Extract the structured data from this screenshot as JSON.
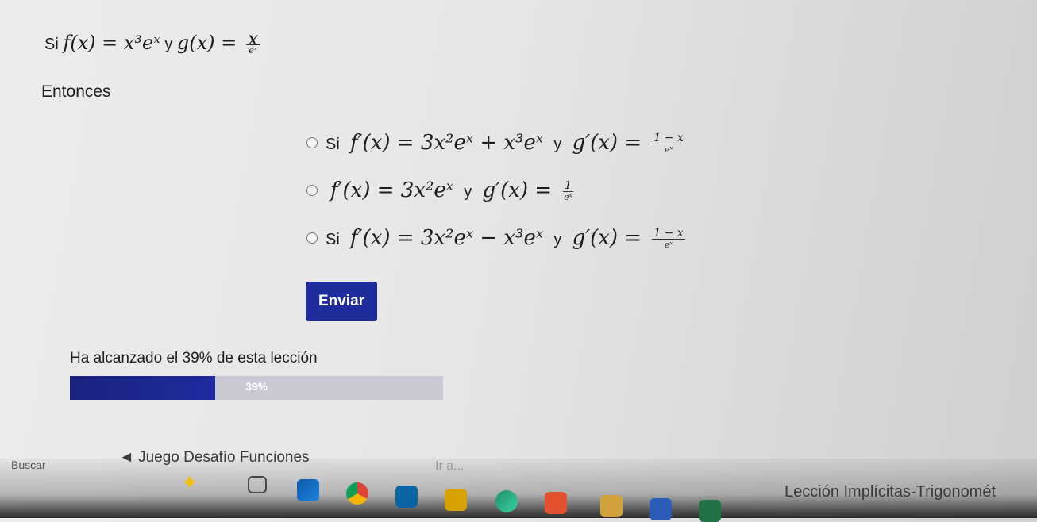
{
  "question": {
    "si": "Si",
    "f": "f(x) = x³eˣ",
    "y": "y",
    "g_lhs": "g(x) =",
    "g_num": "x",
    "g_den": "eˣ"
  },
  "entonces": "Entonces",
  "options": [
    {
      "si": "Si",
      "f": "f′(x) = 3x²eˣ + x³eˣ",
      "y": "y",
      "g_lhs": "g′(x) =",
      "g_num": "1 − x",
      "g_den": "eˣ"
    },
    {
      "si": "",
      "f": "f′(x) = 3x²eˣ",
      "y": "y",
      "g_lhs": "g′(x) =",
      "g_num": "1",
      "g_den": "eˣ"
    },
    {
      "si": "Si",
      "f": "f′(x) = 3x²eˣ − x³eˣ",
      "y": "y",
      "g_lhs": "g′(x) =",
      "g_num": "1 − x",
      "g_den": "eˣ"
    }
  ],
  "submit_label": "Enviar",
  "progress": {
    "label": "Ha alcanzado el 39% de esta lección",
    "percent": 39,
    "text": "39%"
  },
  "nav": {
    "prev": "◄ Juego Desafío Funciones",
    "jump": "Ir a...",
    "next": "Lección Implícitas-Trigonomét"
  },
  "taskbar": {
    "search": "Buscar"
  },
  "colors": {
    "accent": "#1f2d9c",
    "progress_fill": "#1a237e"
  }
}
